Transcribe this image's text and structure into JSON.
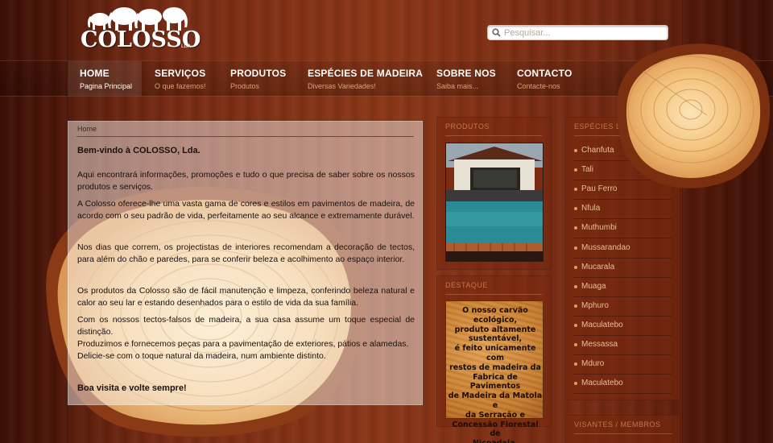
{
  "header": {
    "logo_text": "COLOSSO",
    "logo_suffix": "LDA"
  },
  "search": {
    "placeholder": "Pesquisar..."
  },
  "nav": {
    "items": [
      {
        "title": "HOME",
        "subtitle": "Pagina Principal"
      },
      {
        "title": "SERVIÇOS",
        "subtitle": "O que fazemos!"
      },
      {
        "title": "PRODUTOS",
        "subtitle": "Produtos"
      },
      {
        "title": "ESPÉCIES DE MADEIRA",
        "subtitle": "Diversas Variedades!"
      },
      {
        "title": "SOBRE NOS",
        "subtitle": "Saiba mais..."
      },
      {
        "title": "CONTACTO",
        "subtitle": "Contacte-nos"
      }
    ]
  },
  "main": {
    "breadcrumb": "Home",
    "welcome": "Bem-vindo à COLOSSO, Lda.",
    "p1": "Aqui encontrará informações, promoções e tudo o que precisa de saber sobre os nossos produtos e serviços.",
    "p2": "A Colosso oferece-lhe uma vasta gama de cores e estilos em pavimentos de madeira, de acordo com o seu padrão de vida, perfeitamente ao seu alcance e extremamente durável.",
    "p3": "Nos dias que correm, os projectistas de interiores recomendam a decoração de tectos, para além do chão e paredes, para se conferir beleza e acolhimento ao espaço interior.",
    "p4": "Os produtos da Colosso são de fácil manutenção e limpeza, conferindo beleza natural e calor ao seu lar e estando desenhados para o estilo de vida da sua família.",
    "p5": "Com os nossos tectos-falsos de madeira, a sua casa assume um toque especial de distinção.",
    "p6": "Produzimos e fornecemos peças para a pavimentação de exteriores, pátios e alamedas.",
    "p7": "Delicie-se com o toque natural da madeira, num ambiente distinto.",
    "bye": "Boa visita e volte sempre!"
  },
  "products": {
    "heading": "PRODUTOS"
  },
  "highlight": {
    "heading": "DESTAQUE",
    "text": "O nosso carvão\necológico,\nproduto altamente\nsustentável,\né feito unicamente com\nrestos de madeira da\nFabrica de Pavimentos\nde Madeira da Matola e\nda Serração e\nConcessão Florestal de\nNicoadala."
  },
  "species": {
    "heading": "ESPÉCIES DE MADEIRA",
    "items": [
      "Chanfuta",
      "Tali",
      "Pau Ferro",
      "Nfula",
      "Muthumbi",
      "Mussarandao",
      "Mucarala",
      "Muaga",
      "Mphuro",
      "Maculatebo",
      "Messassa",
      "Mduro",
      "Maculatebo"
    ]
  },
  "visitors": {
    "heading": "VISANTES / MEMBROS"
  },
  "colors": {
    "accent": "#d9a46a",
    "list_text": "#e8c090"
  }
}
